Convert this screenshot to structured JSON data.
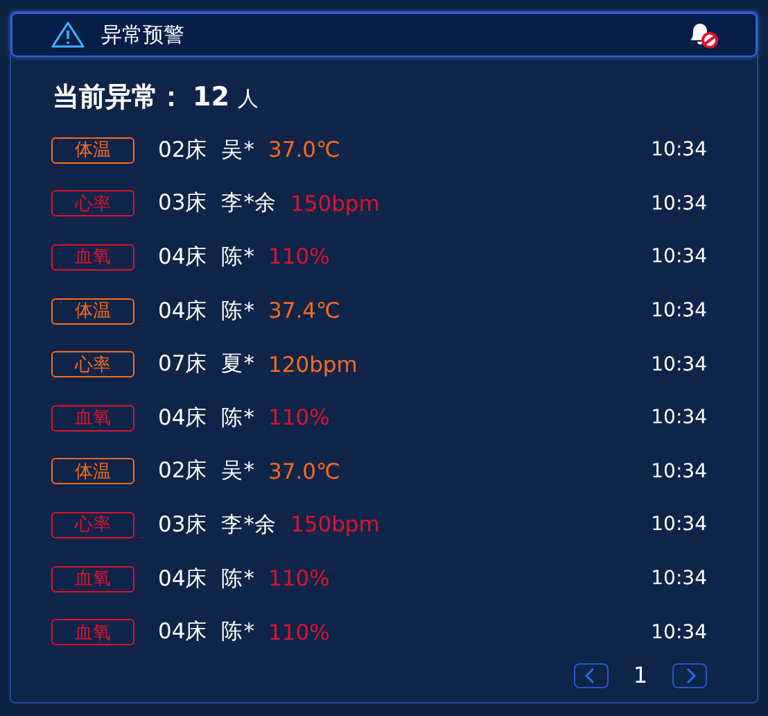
{
  "header": {
    "title": "异常预警"
  },
  "summary": {
    "label": "当前异常：",
    "count": "12",
    "unit": "人"
  },
  "alerts": [
    {
      "tag": "体温",
      "color": "#ff6a1a",
      "bed": "02床",
      "name": "吴*",
      "value": "37.0℃",
      "time": "10:34"
    },
    {
      "tag": "心率",
      "color": "#e0122c",
      "bed": "03床",
      "name": "李*余",
      "value": "150bpm",
      "time": "10:34"
    },
    {
      "tag": "血氧",
      "color": "#e0122c",
      "bed": "04床",
      "name": "陈*",
      "value": "110%",
      "time": "10:34"
    },
    {
      "tag": "体温",
      "color": "#ff6a1a",
      "bed": "04床",
      "name": "陈*",
      "value": "37.4℃",
      "time": "10:34"
    },
    {
      "tag": "心率",
      "color": "#ff6a1a",
      "bed": "07床",
      "name": "夏*",
      "value": "120bpm",
      "time": "10:34"
    },
    {
      "tag": "血氧",
      "color": "#e0122c",
      "bed": "04床",
      "name": "陈*",
      "value": "110%",
      "time": "10:34"
    },
    {
      "tag": "体温",
      "color": "#ff6a1a",
      "bed": "02床",
      "name": "吴*",
      "value": "37.0℃",
      "time": "10:34"
    },
    {
      "tag": "心率",
      "color": "#e0122c",
      "bed": "03床",
      "name": "李*余",
      "value": "150bpm",
      "time": "10:34"
    },
    {
      "tag": "血氧",
      "color": "#e0122c",
      "bed": "04床",
      "name": "陈*",
      "value": "110%",
      "time": "10:34"
    },
    {
      "tag": "血氧",
      "color": "#e0122c",
      "bed": "04床",
      "name": "陈*",
      "value": "110%",
      "time": "10:34"
    }
  ],
  "pagination": {
    "page": "1"
  }
}
